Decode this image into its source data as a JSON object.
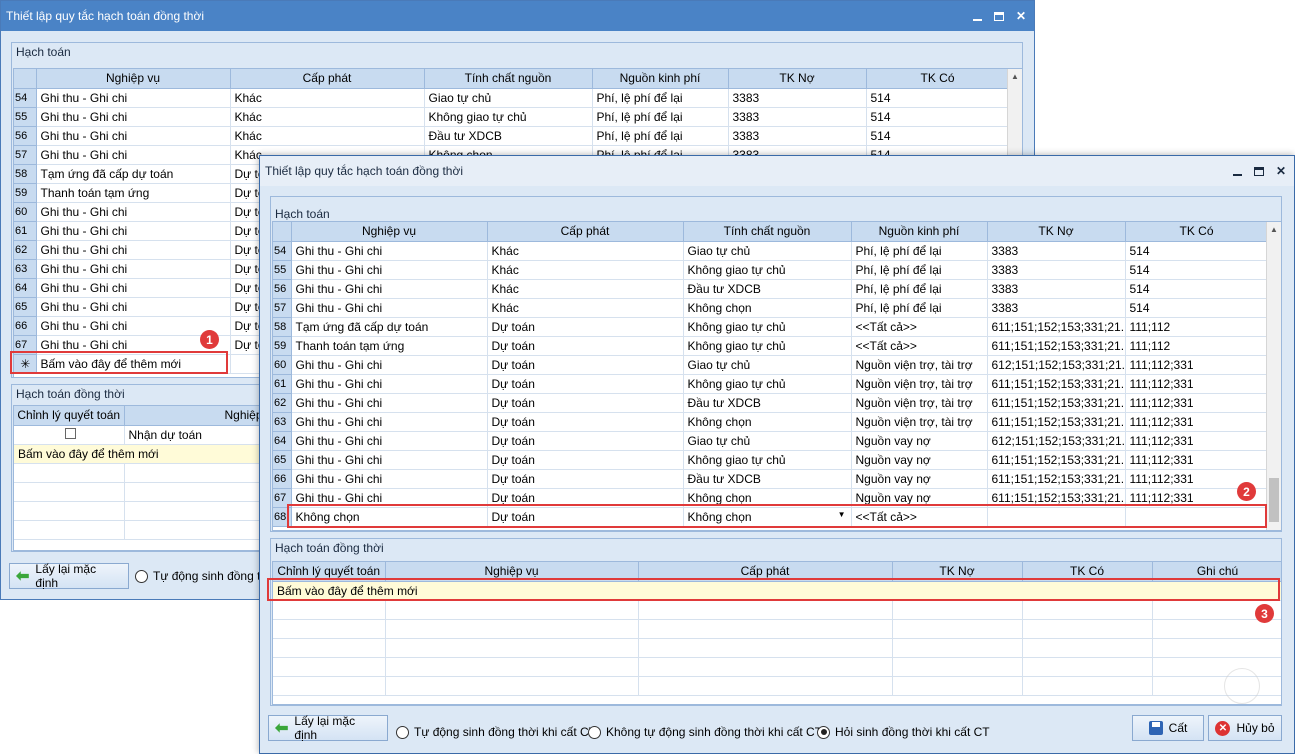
{
  "back_window": {
    "title": "Thiết lập quy tắc hạch toán đồng thời",
    "hach_toan_label": "Hạch toán",
    "columns": [
      "Nghiệp vụ",
      "Cấp phát",
      "Tính chất nguồn",
      "Nguồn kinh phí",
      "TK Nợ",
      "TK Có"
    ],
    "rows": [
      {
        "n": "54",
        "nv": "Ghi thu - Ghi chi",
        "cp": "Khác",
        "tcn": "Giao tự chủ",
        "nkp": "Phí, lệ phí để lại",
        "no": "3383",
        "co": "514"
      },
      {
        "n": "55",
        "nv": "Ghi thu - Ghi chi",
        "cp": "Khác",
        "tcn": "Không giao tự chủ",
        "nkp": "Phí, lệ phí để lại",
        "no": "3383",
        "co": "514"
      },
      {
        "n": "56",
        "nv": "Ghi thu - Ghi chi",
        "cp": "Khác",
        "tcn": "Đầu tư XDCB",
        "nkp": "Phí, lệ phí để lại",
        "no": "3383",
        "co": "514"
      },
      {
        "n": "57",
        "nv": "Ghi thu - Ghi chi",
        "cp": "Khác",
        "tcn": "Không chọn",
        "nkp": "Phí, lệ phí để lại",
        "no": "3383",
        "co": "514"
      },
      {
        "n": "58",
        "nv": "Tạm ứng đã cấp dự toán",
        "cp": "Dự toán",
        "tcn": "",
        "nkp": "",
        "no": "",
        "co": ""
      },
      {
        "n": "59",
        "nv": "Thanh toán tạm ứng",
        "cp": "Dự toán",
        "tcn": "",
        "nkp": "",
        "no": "",
        "co": ""
      },
      {
        "n": "60",
        "nv": "Ghi thu - Ghi chi",
        "cp": "Dự toán",
        "tcn": "",
        "nkp": "",
        "no": "",
        "co": ""
      },
      {
        "n": "61",
        "nv": "Ghi thu - Ghi chi",
        "cp": "Dự toán",
        "tcn": "",
        "nkp": "",
        "no": "",
        "co": ""
      },
      {
        "n": "62",
        "nv": "Ghi thu - Ghi chi",
        "cp": "Dự toán",
        "tcn": "",
        "nkp": "",
        "no": "",
        "co": ""
      },
      {
        "n": "63",
        "nv": "Ghi thu - Ghi chi",
        "cp": "Dự toán",
        "tcn": "",
        "nkp": "",
        "no": "",
        "co": ""
      },
      {
        "n": "64",
        "nv": "Ghi thu - Ghi chi",
        "cp": "Dự toán",
        "tcn": "",
        "nkp": "",
        "no": "",
        "co": ""
      },
      {
        "n": "65",
        "nv": "Ghi thu - Ghi chi",
        "cp": "Dự toán",
        "tcn": "",
        "nkp": "",
        "no": "",
        "co": ""
      },
      {
        "n": "66",
        "nv": "Ghi thu - Ghi chi",
        "cp": "Dự toán",
        "tcn": "",
        "nkp": "",
        "no": "",
        "co": ""
      },
      {
        "n": "67",
        "nv": "Ghi thu - Ghi chi",
        "cp": "Dự toán",
        "tcn": "",
        "nkp": "",
        "no": "",
        "co": ""
      }
    ],
    "add_row_symbol": "✳",
    "add_row_text": "Bấm vào đây để thêm mới",
    "dongthoi_label": "Hạch toán đồng thời",
    "dongthoi_columns": [
      "Chỉnh lý quyết toán",
      "Nghiệp"
    ],
    "dongthoi_row_value": "Nhận dự toán",
    "dongthoi_add_text": "Bấm vào đây để thêm mới",
    "reset_button": "Lấy lại mặc định",
    "radio_partial": "Tự động sinh đồng thời"
  },
  "front_window": {
    "title": "Thiết lập quy tắc hạch toán đồng thời",
    "hach_toan_label": "Hạch toán",
    "columns": [
      "Nghiệp vụ",
      "Cấp phát",
      "Tính chất nguồn",
      "Nguồn kinh phí",
      "TK Nợ",
      "TK Có"
    ],
    "rows": [
      {
        "n": "54",
        "nv": "Ghi thu - Ghi chi",
        "cp": "Khác",
        "tcn": "Giao tự chủ",
        "nkp": "Phí, lệ phí để lại",
        "no": "3383",
        "co": "514"
      },
      {
        "n": "55",
        "nv": "Ghi thu - Ghi chi",
        "cp": "Khác",
        "tcn": "Không giao tự chủ",
        "nkp": "Phí, lệ phí để lại",
        "no": "3383",
        "co": "514"
      },
      {
        "n": "56",
        "nv": "Ghi thu - Ghi chi",
        "cp": "Khác",
        "tcn": "Đầu tư XDCB",
        "nkp": "Phí, lệ phí để lại",
        "no": "3383",
        "co": "514"
      },
      {
        "n": "57",
        "nv": "Ghi thu - Ghi chi",
        "cp": "Khác",
        "tcn": "Không chọn",
        "nkp": "Phí, lệ phí để lại",
        "no": "3383",
        "co": "514"
      },
      {
        "n": "58",
        "nv": "Tạm ứng đã cấp dự toán",
        "cp": "Dự toán",
        "tcn": "Không giao tự chủ",
        "nkp": "<<Tất cả>>",
        "no": "611;151;152;153;331;21...",
        "co": "111;112"
      },
      {
        "n": "59",
        "nv": "Thanh toán tạm ứng",
        "cp": "Dự toán",
        "tcn": "Không giao tự chủ",
        "nkp": "<<Tất cả>>",
        "no": "611;151;152;153;331;21...",
        "co": "111;112"
      },
      {
        "n": "60",
        "nv": "Ghi thu - Ghi chi",
        "cp": "Dự toán",
        "tcn": "Giao tự chủ",
        "nkp": "Nguồn viện trợ, tài trợ",
        "no": "612;151;152;153;331;21...",
        "co": "111;112;331"
      },
      {
        "n": "61",
        "nv": "Ghi thu - Ghi chi",
        "cp": "Dự toán",
        "tcn": "Không giao tự chủ",
        "nkp": "Nguồn viện trợ, tài trợ",
        "no": "611;151;152;153;331;21...",
        "co": "111;112;331"
      },
      {
        "n": "62",
        "nv": "Ghi thu - Ghi chi",
        "cp": "Dự toán",
        "tcn": "Đầu tư XDCB",
        "nkp": "Nguồn viện trợ, tài trợ",
        "no": "611;151;152;153;331;21...",
        "co": "111;112;331"
      },
      {
        "n": "63",
        "nv": "Ghi thu - Ghi chi",
        "cp": "Dự toán",
        "tcn": "Không chọn",
        "nkp": "Nguồn viện trợ, tài trợ",
        "no": "611;151;152;153;331;21...",
        "co": "111;112;331"
      },
      {
        "n": "64",
        "nv": "Ghi thu - Ghi chi",
        "cp": "Dự toán",
        "tcn": "Giao tự chủ",
        "nkp": "Nguồn vay nợ",
        "no": "612;151;152;153;331;21...",
        "co": "111;112;331"
      },
      {
        "n": "65",
        "nv": "Ghi thu - Ghi chi",
        "cp": "Dự toán",
        "tcn": "Không giao tự chủ",
        "nkp": "Nguồn vay nợ",
        "no": "611;151;152;153;331;21...",
        "co": "111;112;331"
      },
      {
        "n": "66",
        "nv": "Ghi thu - Ghi chi",
        "cp": "Dự toán",
        "tcn": "Đầu tư XDCB",
        "nkp": "Nguồn vay nợ",
        "no": "611;151;152;153;331;21...",
        "co": "111;112;331"
      },
      {
        "n": "67",
        "nv": "Ghi thu - Ghi chi",
        "cp": "Dự toán",
        "tcn": "Không chọn",
        "nkp": "Nguồn vay nợ",
        "no": "611;151;152;153;331;21...",
        "co": "111;112;331"
      }
    ],
    "edit_row": {
      "n": "68",
      "nv": "Không chọn",
      "cp": "Dự toán",
      "tcn": "Không chọn",
      "nkp": "<<Tất cả>>",
      "no": "",
      "co": ""
    },
    "dongthoi_label": "Hạch toán đồng thời",
    "dongthoi_columns": [
      "Chỉnh lý quyết toán",
      "Nghiệp vụ",
      "Cấp phát",
      "TK Nợ",
      "TK Có",
      "Ghi chú"
    ],
    "dongthoi_add_text": "Bấm vào đây để thêm mới",
    "reset_button": "Lấy lại mặc định",
    "radios": [
      {
        "label": "Tự động sinh đồng thời khi cất CT",
        "selected": false
      },
      {
        "label": "Không tự động sinh đồng thời khi cất CT",
        "selected": false
      },
      {
        "label": "Hỏi sinh đồng thời khi cất CT",
        "selected": true
      }
    ],
    "save_button": "Cất",
    "cancel_button": "Hủy bỏ"
  },
  "badges": [
    "1",
    "2",
    "3"
  ],
  "window_controls": {
    "minimize": "minimize-icon",
    "maximize": "maximize-icon",
    "close": "close-icon",
    "close_glyph": "✕"
  },
  "colors": {
    "highlight_red": "#e03a3a",
    "add_row_yellow": "#fffbd8",
    "header_blue": "#c8dbf0"
  }
}
